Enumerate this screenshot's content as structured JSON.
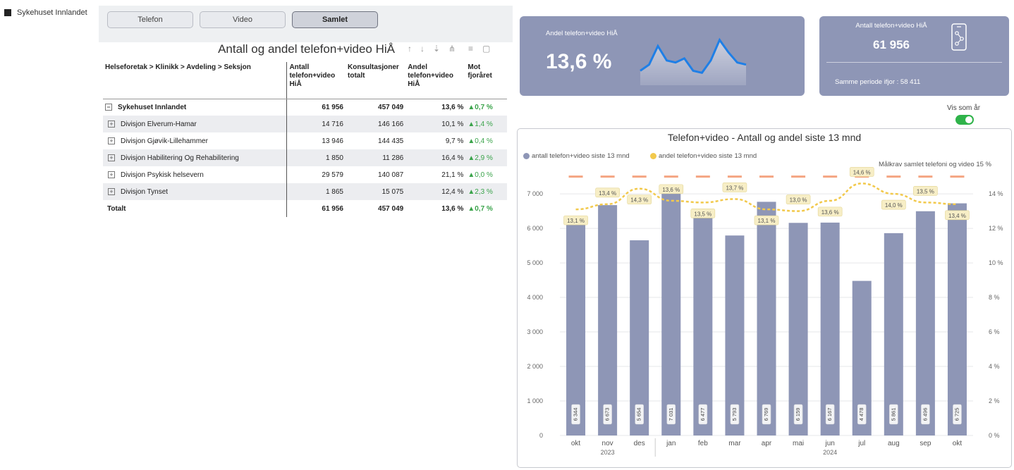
{
  "slicer": {
    "label": "Sykehuset Innlandet"
  },
  "tabs": [
    {
      "label": "Telefon"
    },
    {
      "label": "Video"
    },
    {
      "label": "Samlet"
    }
  ],
  "table": {
    "title": "Antall og andel telefon+video HiÅ",
    "headers": [
      "Helseforetak > Klinikk > Avdeling > Seksjon",
      "Antall telefon+video HiÅ",
      "Konsultasjoner totalt",
      "Andel telefon+video HiÅ",
      "Mot fjoråret"
    ],
    "rows": [
      {
        "name": "Sykehuset Innlandet",
        "antall": "61 956",
        "konsult": "457 049",
        "andel": "13,6 %",
        "mot": "▲0,7 %"
      },
      {
        "name": "Divisjon Elverum-Hamar",
        "antall": "14 716",
        "konsult": "146 166",
        "andel": "10,1 %",
        "mot": "▲1,4 %"
      },
      {
        "name": "Divisjon Gjøvik-Lillehammer",
        "antall": "13 946",
        "konsult": "144 435",
        "andel": "9,7 %",
        "mot": "▲0,4 %"
      },
      {
        "name": "Divisjon Habilitering Og Rehabilitering",
        "antall": "1 850",
        "konsult": "11 286",
        "andel": "16,4 %",
        "mot": "▲2,9 %"
      },
      {
        "name": "Divisjon Psykisk helsevern",
        "antall": "29 579",
        "konsult": "140 087",
        "andel": "21,1 %",
        "mot": "▲0,0 %"
      },
      {
        "name": "Divisjon Tynset",
        "antall": "1 865",
        "konsult": "15 075",
        "andel": "12,4 %",
        "mot": "▲2,3 %"
      }
    ],
    "total": {
      "name": "Totalt",
      "antall": "61 956",
      "konsult": "457 049",
      "andel": "13,6 %",
      "mot": "▲0,7 %"
    }
  },
  "kpi_share": {
    "label": "Andel telefon+video HiÅ",
    "value": "13,6 %",
    "sparkline": [
      13.1,
      13.4,
      14.3,
      13.6,
      13.5,
      13.7,
      13.1,
      13.0,
      13.6,
      14.6,
      14.0,
      13.5,
      13.4
    ]
  },
  "kpi_count": {
    "label": "Antall telefon+video HiÅ",
    "value": "61 956",
    "prev": "Samme periode ifjor : 58 411",
    "icon": "phone-network-icon"
  },
  "toggle": {
    "label": "Vis som år",
    "on": true
  },
  "chart_data": {
    "type": "bar",
    "title": "Telefon+video - Antall og andel siste 13 mnd",
    "categories": [
      "okt",
      "nov",
      "des",
      "jan",
      "feb",
      "mar",
      "apr",
      "mai",
      "jun",
      "jul",
      "aug",
      "sep",
      "okt"
    ],
    "year_labels": [
      "2023",
      "2024"
    ],
    "series": [
      {
        "name": "antall telefon+video siste 13 mnd",
        "values": [
          6344,
          6673,
          5654,
          7031,
          6477,
          5793,
          6769,
          6159,
          6167,
          4478,
          5861,
          6496,
          6725
        ],
        "labels": [
          "6 344",
          "6 673",
          "5 654",
          "7 031",
          "6 477",
          "5 793",
          "6 769",
          "6 159",
          "6 167",
          "4 478",
          "5 861",
          "6 496",
          "6 725"
        ]
      },
      {
        "name": "andel telefon+video siste 13 mnd",
        "values": [
          13.1,
          13.4,
          14.3,
          13.6,
          13.5,
          13.7,
          13.1,
          13.0,
          13.6,
          14.6,
          14.0,
          13.5,
          13.4
        ],
        "labels": [
          "13,1 %",
          "13,4 %",
          "14,3 %",
          "13,6 %",
          "13,5 %",
          "13,7 %",
          "13,1 %",
          "13,0 %",
          "13,6 %",
          "14,6 %",
          "14,0 %",
          "13,5 %",
          "13,4 %"
        ]
      }
    ],
    "target": {
      "label": "Målkrav samlet telefoni og video 15 %",
      "value": 15
    },
    "y_left": {
      "ticks": [
        "0",
        "1 000",
        "2 000",
        "3 000",
        "4 000",
        "5 000",
        "6 000",
        "7 000"
      ],
      "ylim": [
        0,
        7900
      ]
    },
    "y_right": {
      "ticks": [
        "0 %",
        "2 %",
        "4 %",
        "6 %",
        "8 %",
        "10 %",
        "12 %",
        "14 %"
      ],
      "ylim": [
        0,
        15.8
      ]
    },
    "colors": {
      "bar": "#8e96b6",
      "line": "#f2c94c",
      "target": "#f4a582"
    }
  }
}
